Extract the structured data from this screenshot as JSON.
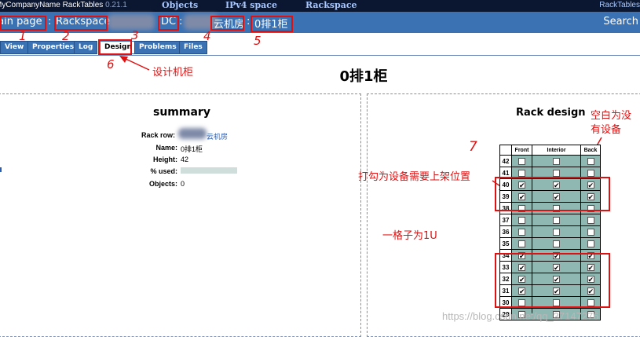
{
  "app": {
    "name": "MyCompanyName RackTables",
    "version": "0.21.1",
    "right_label": "RackTables"
  },
  "top_nav": [
    {
      "label": "Objects"
    },
    {
      "label": "IPv4 space"
    },
    {
      "label": "Rackspace"
    }
  ],
  "breadcrumbs": [
    {
      "label": "Main page"
    },
    {
      "label": "Rackspace"
    },
    {
      "label": "DC"
    },
    {
      "label": "云机房"
    },
    {
      "label": "0排1柜"
    }
  ],
  "search_label": "Search",
  "tabs": [
    {
      "label": "View",
      "active": false
    },
    {
      "label": "Properties",
      "active": false
    },
    {
      "label": "Log",
      "active": false
    },
    {
      "label": "Design",
      "active": true
    },
    {
      "label": "Problems",
      "active": false
    },
    {
      "label": "Files",
      "active": false
    }
  ],
  "annotations": {
    "numbers": [
      "1",
      "2",
      "3",
      "4",
      "5",
      "6",
      "7"
    ],
    "design_rack": "设计机柜",
    "blank_no_device_1": "空白为没",
    "blank_no_device_2": "有设备",
    "checked_meaning": "打勾为设备需要上架位置",
    "one_cell_1u": "一格子为1U",
    "colors": {
      "annotation": "#e01010"
    }
  },
  "page_title": "0排1柜",
  "summary": {
    "title": "summary",
    "rows": [
      {
        "label": "Rack row:",
        "value": "云机房"
      },
      {
        "label": "Name:",
        "value": "0排1柜"
      },
      {
        "label": "Height:",
        "value": "42"
      },
      {
        "label": "% used:",
        "value": ""
      },
      {
        "label": "Objects:",
        "value": "0"
      }
    ],
    "used_fraction": 0
  },
  "rack_design": {
    "title": "Rack design",
    "columns": [
      "Front",
      "Interior",
      "Back"
    ],
    "rows": [
      {
        "unit": "42",
        "front": false,
        "interior": false,
        "back": false
      },
      {
        "unit": "41",
        "front": false,
        "interior": false,
        "back": false
      },
      {
        "unit": "40",
        "front": true,
        "interior": true,
        "back": true
      },
      {
        "unit": "39",
        "front": true,
        "interior": true,
        "back": true
      },
      {
        "unit": "38",
        "front": false,
        "interior": false,
        "back": false
      },
      {
        "unit": "37",
        "front": false,
        "interior": false,
        "back": false
      },
      {
        "unit": "36",
        "front": false,
        "interior": false,
        "back": false
      },
      {
        "unit": "35",
        "front": false,
        "interior": false,
        "back": false
      },
      {
        "unit": "34",
        "front": true,
        "interior": true,
        "back": true
      },
      {
        "unit": "33",
        "front": true,
        "interior": true,
        "back": true
      },
      {
        "unit": "32",
        "front": true,
        "interior": true,
        "back": true
      },
      {
        "unit": "31",
        "front": true,
        "interior": true,
        "back": true
      },
      {
        "unit": "30",
        "front": false,
        "interior": false,
        "back": false
      },
      {
        "unit": "29",
        "front": false,
        "interior": false,
        "back": false
      }
    ]
  },
  "watermark": "https://blog.csdn.net/qq_37147276",
  "colors": {
    "topbar": "#0b1630",
    "pathbar": "#3a72b4",
    "rack_cell": "#8fb8b3"
  }
}
